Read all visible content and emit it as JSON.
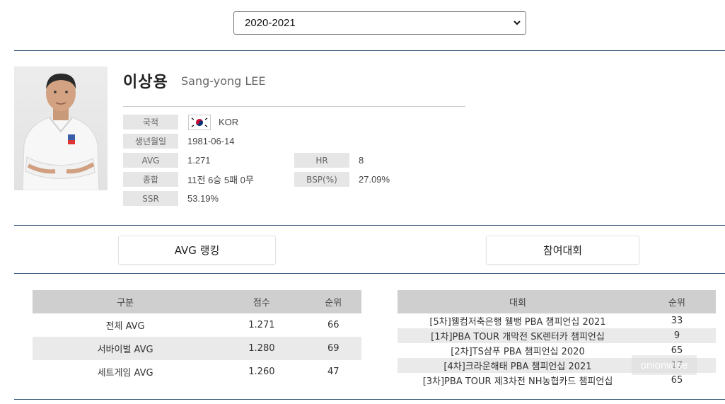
{
  "season_select": {
    "value": "2020-2021"
  },
  "player": {
    "name_ko": "이상용",
    "name_en": "Sang-yong LEE",
    "fields": {
      "nationality_label": "국적",
      "nationality_value": "KOR",
      "birth_label": "생년월일",
      "birth_value": "1981-06-14",
      "avg_label": "AVG",
      "avg_value": "1.271",
      "hr_label": "HR",
      "hr_value": "8",
      "total_label": "종합",
      "total_value": "11전 6승 5패 0무",
      "bsp_label": "BSP(%)",
      "bsp_value": "27.09%",
      "ssr_label": "SSR",
      "ssr_value": "53.19%"
    }
  },
  "tabs": {
    "avg_ranking": "AVG 랭킹",
    "tournaments": "참여대회"
  },
  "avg_table": {
    "headers": [
      "구분",
      "점수",
      "순위"
    ],
    "rows": [
      [
        "전체 AVG",
        "1.271",
        "66"
      ],
      [
        "서바이벌 AVG",
        "1.280",
        "69"
      ],
      [
        "세트게임 AVG",
        "1.260",
        "47"
      ]
    ]
  },
  "tournament_table": {
    "headers": [
      "대회",
      "순위"
    ],
    "rows": [
      [
        "[5차]웰컴저축은행 웰뱅 PBA 챔피언십 2021",
        "33"
      ],
      [
        "[1차]PBA TOUR 개막전 SK렌터카 챔피언십",
        "9"
      ],
      [
        "[2차]TS샴푸 PBA 챔피언십 2020",
        "65"
      ],
      [
        "[4차]크라운해태 PBA 챔피언십 2021",
        "17"
      ],
      [
        "[3차]PBA TOUR 제3차전 NH농협카드 챔피언십",
        "65"
      ]
    ]
  },
  "watermark": "onionwise",
  "colors": {
    "divider": "#3a5a7a",
    "label_bg": "#e6e6e6",
    "header_bg": "#cfcfcf"
  }
}
